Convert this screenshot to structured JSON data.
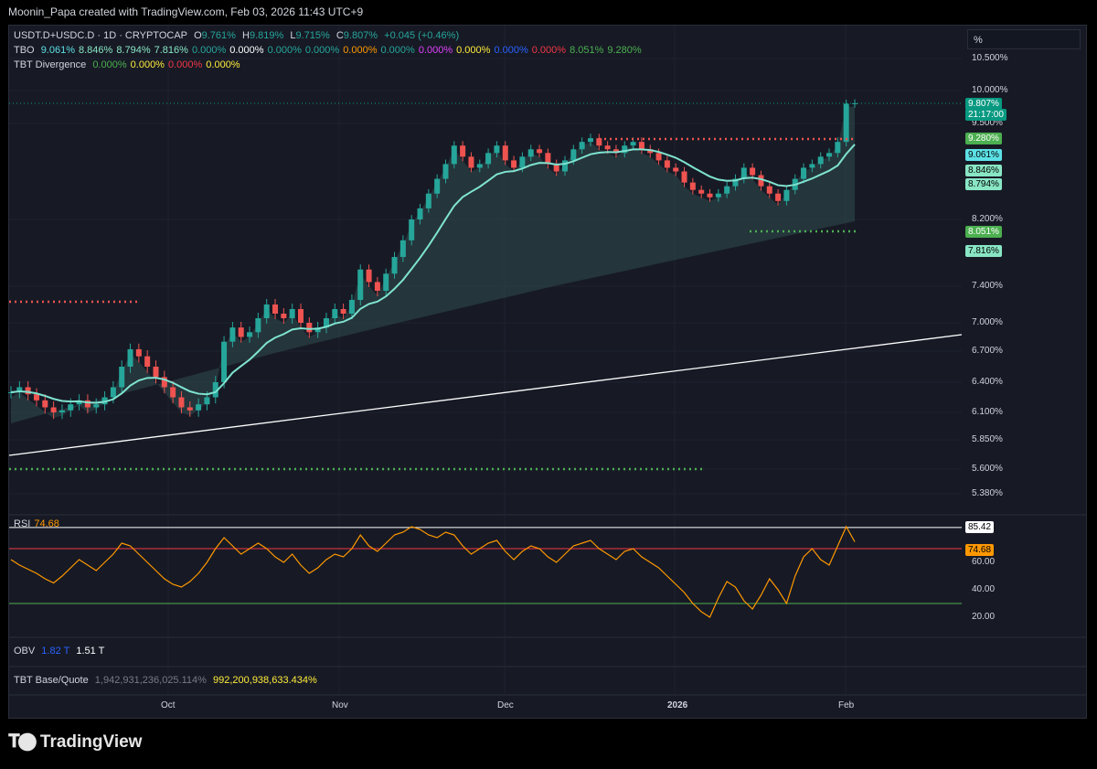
{
  "caption": "Moonin_Papa created with TradingView.com, Feb 03, 2026 11:43 UTC+9",
  "symbol_line": {
    "symbol": "USDT.D+USDC.D · 1D · CRYPTOCAP",
    "o_label": "O",
    "o_value": "9.761%",
    "h_label": "H",
    "h_value": "9.819%",
    "l_label": "L",
    "l_value": "9.715%",
    "c_label": "C",
    "c_value": "9.807%",
    "change": "+0.045 (+0.46%)"
  },
  "tbo_line": {
    "label": "TBO",
    "values": [
      {
        "text": "9.061%",
        "color": "#5ce1e6"
      },
      {
        "text": "8.846%",
        "color": "#89e6c5"
      },
      {
        "text": "8.794%",
        "color": "#89e6c5"
      },
      {
        "text": "7.816%",
        "color": "#89e6c5"
      },
      {
        "text": "0.000%",
        "color": "#26a69a"
      },
      {
        "text": "0.000%",
        "color": "#ffffff"
      },
      {
        "text": "0.000%",
        "color": "#26a69a"
      },
      {
        "text": "0.000%",
        "color": "#26a69a"
      },
      {
        "text": "0.000%",
        "color": "#ff9800"
      },
      {
        "text": "0.000%",
        "color": "#26a69a"
      },
      {
        "text": "0.000%",
        "color": "#e040fb"
      },
      {
        "text": "0.000%",
        "color": "#ffeb3b"
      },
      {
        "text": "0.000%",
        "color": "#2962ff"
      },
      {
        "text": "0.000%",
        "color": "#f23645"
      },
      {
        "text": "8.051%",
        "color": "#4caf50"
      },
      {
        "text": "9.280%",
        "color": "#4caf50"
      }
    ]
  },
  "divergence_line": {
    "label": "TBT Divergence",
    "values": [
      {
        "text": "0.000%",
        "color": "#4caf50"
      },
      {
        "text": "0.000%",
        "color": "#ffeb3b"
      },
      {
        "text": "0.000%",
        "color": "#f23645"
      },
      {
        "text": "0.000%",
        "color": "#ffeb3b"
      }
    ]
  },
  "scale_mode": "%",
  "price_axis_ticks": [
    "10.500%",
    "10.000%",
    "9.500%",
    "8.200%",
    "7.400%",
    "7.000%",
    "6.700%",
    "6.400%",
    "6.100%",
    "5.850%",
    "5.600%",
    "5.380%"
  ],
  "price_pills": [
    {
      "text": "9.807%",
      "bg": "#089981",
      "fg": "#ffffff"
    },
    {
      "text": "21:17:00",
      "bg": "#089981",
      "fg": "#ffffff"
    },
    {
      "text": "9.280%",
      "bg": "#4caf50",
      "fg": "#ffffff"
    },
    {
      "text": "9.061%",
      "bg": "#5ce1e6",
      "fg": "#000000"
    },
    {
      "text": "8.846%",
      "bg": "#89e6c5",
      "fg": "#000000"
    },
    {
      "text": "8.794%",
      "bg": "#89e6c5",
      "fg": "#000000"
    },
    {
      "text": "8.051%",
      "bg": "#4caf50",
      "fg": "#ffffff"
    },
    {
      "text": "7.816%",
      "bg": "#89e6c5",
      "fg": "#000000"
    }
  ],
  "rsi": {
    "label": "RSI",
    "value": "74.68",
    "ticks": [
      "60.00",
      "40.00",
      "20.00"
    ],
    "pill_high": "85.42",
    "pill_value": "74.68"
  },
  "obv": {
    "label": "OBV",
    "v1": "1.82 T",
    "v2": "1.51 T"
  },
  "base_quote": {
    "label": "TBT Base/Quote",
    "v1": "1,942,931,236,025.114%",
    "v2": "992,200,938,633.434%"
  },
  "time_axis": [
    "Oct",
    "Nov",
    "Dec",
    "2026",
    "Feb"
  ],
  "brand": "TradingView",
  "colors": {
    "up": "#26a69a",
    "down": "#ef5350",
    "rsi": "#ff9800",
    "ema": "#7fe3d0",
    "trendline": "#ffffff"
  },
  "chart_data": {
    "type": "candlestick",
    "close_series": [
      6.3,
      6.35,
      6.28,
      6.22,
      6.15,
      6.1,
      6.12,
      6.18,
      6.22,
      6.15,
      6.18,
      6.25,
      6.35,
      6.55,
      6.72,
      6.65,
      6.55,
      6.45,
      6.35,
      6.25,
      6.15,
      6.12,
      6.18,
      6.25,
      6.4,
      6.8,
      6.95,
      6.85,
      6.9,
      7.05,
      7.2,
      7.1,
      7.05,
      7.15,
      7.0,
      6.9,
      6.95,
      7.05,
      7.15,
      7.1,
      7.25,
      7.6,
      7.45,
      7.35,
      7.55,
      7.75,
      7.95,
      8.2,
      8.35,
      8.55,
      8.75,
      8.95,
      9.2,
      9.05,
      8.9,
      8.95,
      9.1,
      9.2,
      9.0,
      8.9,
      9.05,
      9.15,
      9.1,
      8.95,
      8.85,
      9.0,
      9.15,
      9.25,
      9.3,
      9.2,
      9.15,
      9.1,
      9.2,
      9.25,
      9.15,
      9.1,
      9.0,
      8.9,
      8.85,
      8.7,
      8.6,
      8.55,
      8.5,
      8.55,
      8.65,
      8.75,
      8.9,
      8.8,
      8.65,
      8.55,
      8.45,
      8.6,
      8.75,
      8.9,
      8.95,
      9.05,
      9.1,
      9.25,
      9.8,
      9.807
    ],
    "rsi_values": [
      62,
      58,
      55,
      52,
      48,
      45,
      50,
      56,
      62,
      58,
      54,
      60,
      66,
      74,
      72,
      66,
      60,
      54,
      48,
      44,
      42,
      46,
      52,
      60,
      70,
      78,
      72,
      66,
      70,
      74,
      70,
      64,
      60,
      66,
      58,
      52,
      56,
      62,
      66,
      64,
      70,
      80,
      72,
      68,
      74,
      80,
      82,
      86,
      84,
      80,
      78,
      82,
      80,
      72,
      66,
      70,
      74,
      76,
      68,
      62,
      68,
      72,
      70,
      64,
      60,
      66,
      72,
      74,
      76,
      70,
      66,
      62,
      68,
      70,
      64,
      60,
      56,
      50,
      44,
      38,
      30,
      24,
      20,
      34,
      46,
      42,
      32,
      26,
      36,
      48,
      40,
      30,
      50,
      64,
      70,
      62,
      58,
      72,
      86,
      75
    ],
    "rsi_levels": {
      "overbought": 70,
      "oversold": 30
    },
    "time_labels": [
      "Oct",
      "Nov",
      "Dec",
      "2026",
      "Feb"
    ]
  }
}
